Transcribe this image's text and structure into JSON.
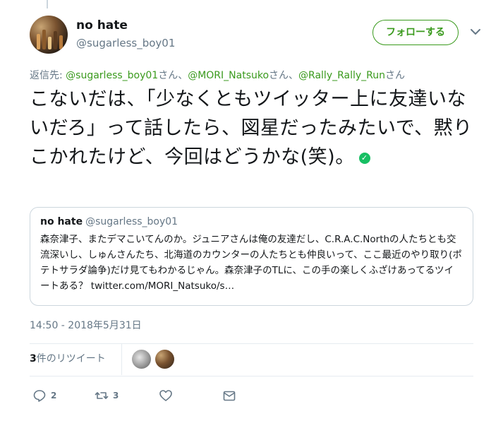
{
  "author": {
    "name": "no hate",
    "handle": "@sugarless_boy01",
    "avatar_icon": "bottles-avatar"
  },
  "follow_button": {
    "label": "フォローする"
  },
  "reply_to": {
    "prefix": "返信先: ",
    "mentions": [
      {
        "handle": "@sugarless_boy01",
        "suffix": "さん、"
      },
      {
        "handle": "@MORI_Natsuko",
        "suffix": "さん、"
      },
      {
        "handle": "@Rally_Rally_Run",
        "suffix": "さん"
      }
    ]
  },
  "tweet": {
    "text": "こないだは、「少なくともツイッター上に友達いないだろ」って話したら、図星だったみたいで、黙りこかれたけど、今回はどうかな(笑)。",
    "emoji": "white-check-mark"
  },
  "quote": {
    "name": "no hate",
    "handle": "@sugarless_boy01",
    "text": "森奈津子、またデマこいてんのか。ジュニアさんは俺の友達だし、C.R.A.C.Northの人たちとも交流深いし、しゅんさんたち、北海道のカウンターの人たちとも仲良いって、ここ最近のやり取り(ポテトサラダ論争)だけ見てもわかるじゃん。森奈津子のTLに、この手の楽しくふざけあってるツイートある？ twitter.com/MORI_Natsuko/s…"
  },
  "timestamp": "14:50 - 2018年5月31日",
  "stats": {
    "retweet_count": "3",
    "retweet_label": "件のリツイート"
  },
  "actions": {
    "reply_count": "2",
    "retweet_count": "3"
  },
  "colors": {
    "accent": "#3a9a1d",
    "secondary_text": "#657786",
    "border": "#ccd6dd"
  }
}
